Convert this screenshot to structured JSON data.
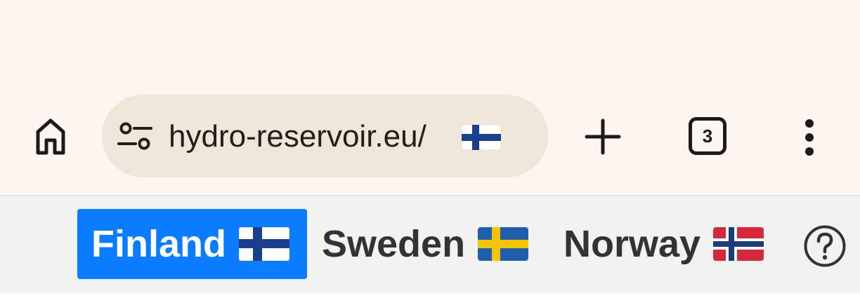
{
  "browser": {
    "url": "hydro-reservoir.eu/",
    "tab_count": "3",
    "icons": {
      "home": "home-icon",
      "site_settings": "tune-icon",
      "new_tab": "plus-icon",
      "tabs": "tab-switcher-icon",
      "menu": "more-vert-icon"
    }
  },
  "nav": {
    "tabs": [
      {
        "label": "Finland",
        "flag": "finland-flag",
        "active": true
      },
      {
        "label": "Sweden",
        "flag": "sweden-flag",
        "active": false
      },
      {
        "label": "Norway",
        "flag": "norway-flag",
        "active": false
      }
    ],
    "help_icon": "help-circle-icon"
  },
  "colors": {
    "chrome_bg": "#fcf5f0",
    "url_bar_bg": "#efe6da",
    "active_tab": "#0a7cff",
    "nav_bg": "#f2f2f2"
  }
}
